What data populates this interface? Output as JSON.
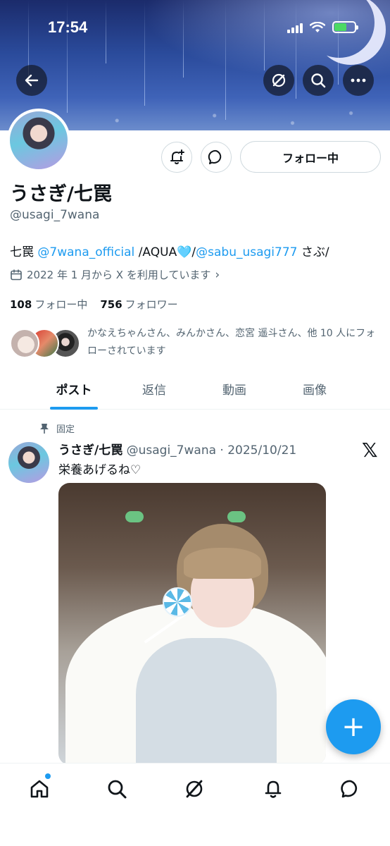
{
  "status_bar": {
    "time": "17:54"
  },
  "profile": {
    "display_name": "うさぎ/七罠",
    "handle": "@usagi_7wana",
    "bio": {
      "prefix": "七罠 ",
      "mention1": "@7wana_official",
      "middle": " /AQUA",
      "heart": "🩵",
      "slash": "/",
      "mention2": "@sabu_usagi777",
      "suffix": " さぶ/"
    },
    "joined": "2022 年 1 月から X を利用しています",
    "following_count": "108",
    "following_label": "フォロー中",
    "followers_count": "756",
    "followers_label": "フォロワー",
    "followed_by": "かなえちゃんさん、みんかさん、恋宮 遥斗さん、他 10 人にフォローされています"
  },
  "actions": {
    "follow_button": "フォロー中"
  },
  "tabs": [
    {
      "label": "ポスト",
      "active": true
    },
    {
      "label": "返信",
      "active": false
    },
    {
      "label": "動画",
      "active": false
    },
    {
      "label": "画像",
      "active": false
    }
  ],
  "post": {
    "pinned_label": "固定",
    "author_name": "うさぎ/七罠",
    "author_meta": " @usagi_7wana · 2025/10/21",
    "text": "栄養あげるね♡"
  },
  "fab": {
    "label": "+"
  },
  "colors": {
    "accent": "#1d9bf0",
    "text_secondary": "#536471",
    "border": "#cfd9de"
  },
  "icons": {
    "back": "arrow-left-icon",
    "grok": "grok-icon",
    "search": "search-icon",
    "more": "more-icon",
    "notify": "bell-plus-icon",
    "message": "message-icon",
    "calendar": "calendar-icon",
    "pin": "pin-icon",
    "x": "x-logo-icon"
  }
}
